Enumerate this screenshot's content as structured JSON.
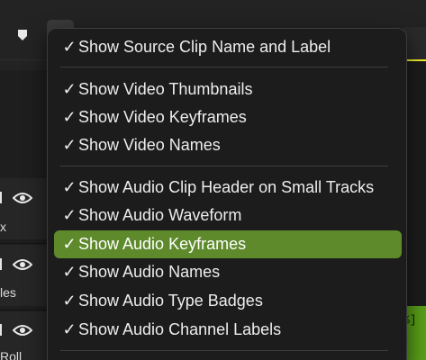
{
  "tracks": [
    {
      "name_fragment": "x"
    },
    {
      "name_fragment": "les"
    },
    {
      "name_fragment": "Roll"
    }
  ],
  "clip": {
    "label_fragment": "%]"
  },
  "menu": {
    "groups": [
      [
        {
          "label": "Show Source Clip Name and Label",
          "checked": "✓"
        }
      ],
      [
        {
          "label": "Show Video Thumbnails",
          "checked": "✓"
        },
        {
          "label": "Show Video Keyframes",
          "checked": "✓"
        },
        {
          "label": "Show Video Names",
          "checked": "✓"
        }
      ],
      [
        {
          "label": "Show Audio Clip Header on Small Tracks",
          "checked": "✓"
        },
        {
          "label": "Show Audio Waveform",
          "checked": "✓"
        },
        {
          "label": "Show Audio Keyframes",
          "checked": "✓"
        },
        {
          "label": "Show Audio Names",
          "checked": "✓"
        },
        {
          "label": "Show Audio Type Badges",
          "checked": "✓"
        },
        {
          "label": "Show Audio Channel Labels",
          "checked": "✓"
        }
      ]
    ],
    "highlighted_item": "Show Audio Keyframes",
    "highlight_color": "#5e8a2c"
  }
}
